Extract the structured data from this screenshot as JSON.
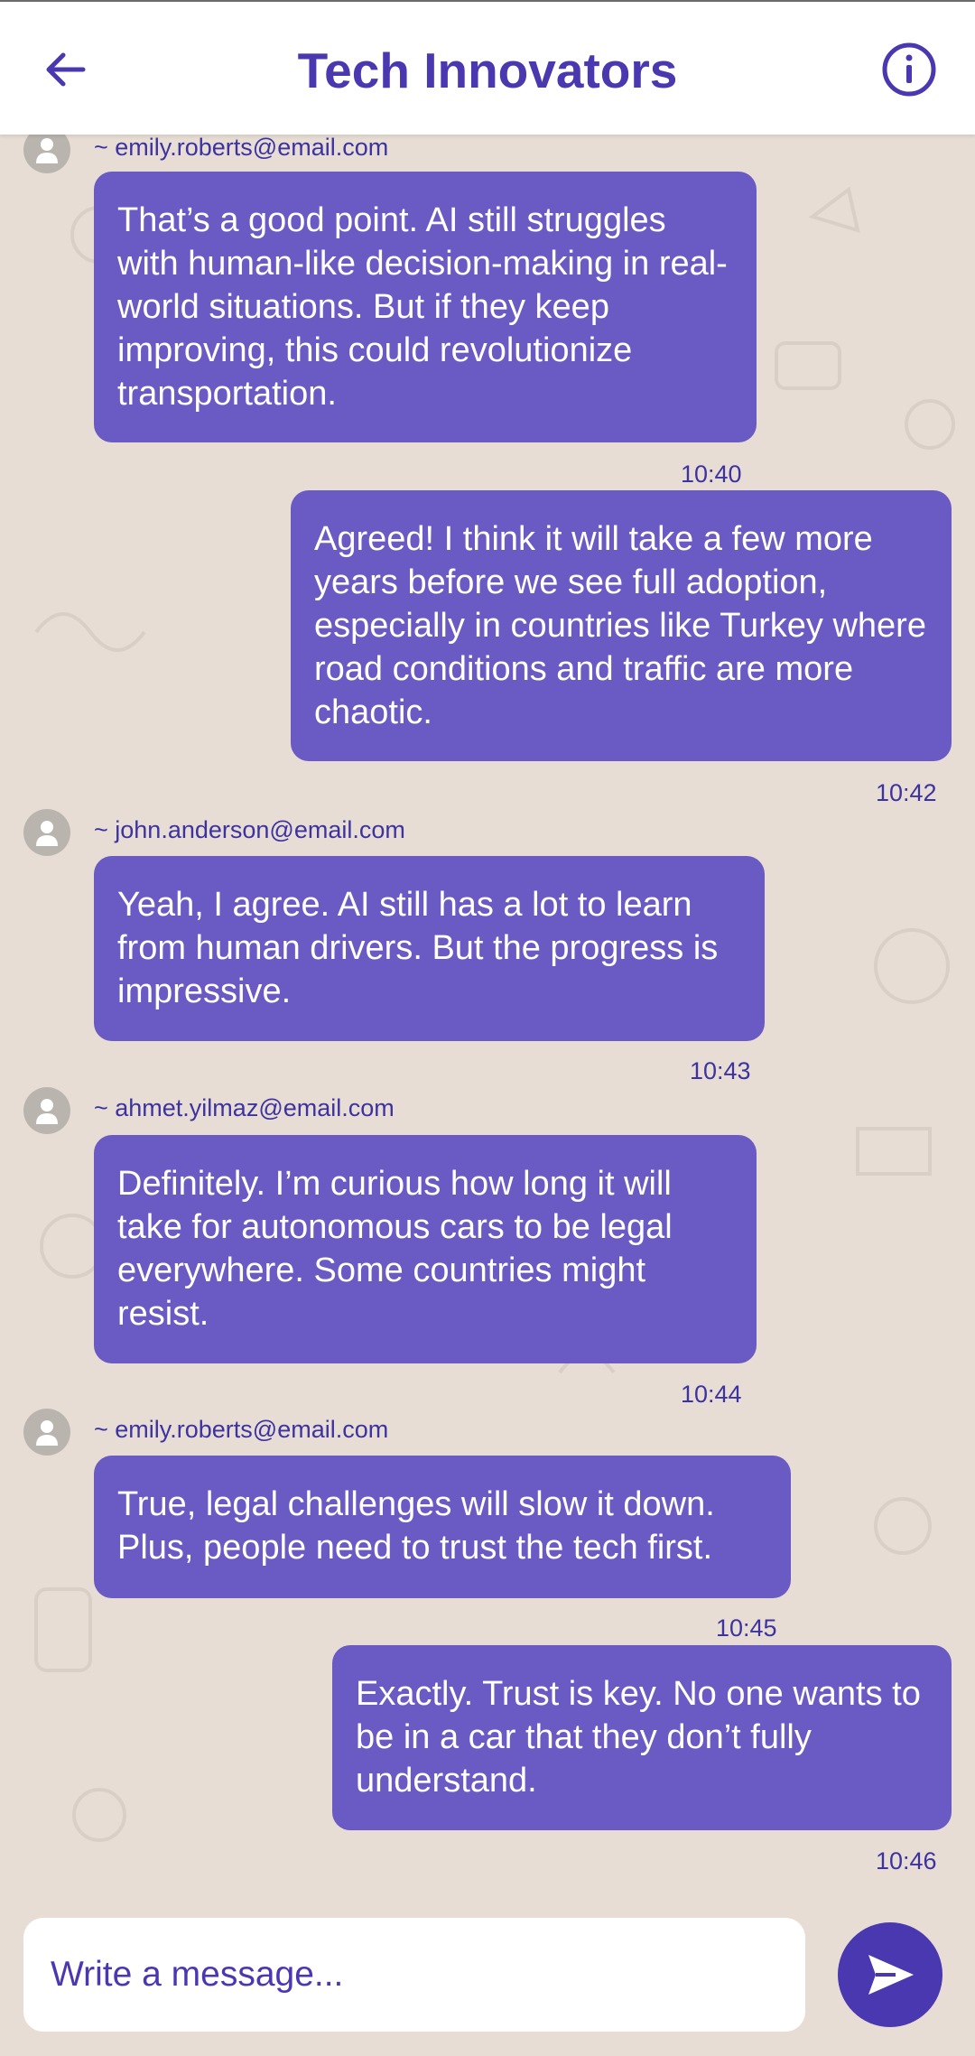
{
  "header": {
    "title": "Tech Innovators",
    "back_icon": "arrow-left-icon",
    "info_icon": "info-icon"
  },
  "messages": [
    {
      "sender": "~ emily.roberts@email.com",
      "text": "That’s a good point. AI still struggles with human-like decision-making in real-world situations. But if they keep improving, this could revolutionize transportation.",
      "time": "10:40",
      "outgoing": false
    },
    {
      "sender": "",
      "text": "Agreed! I think it will take a few more years before we see full adoption, especially in countries like Turkey where road conditions and traffic are more chaotic.",
      "time": "10:42",
      "outgoing": true
    },
    {
      "sender": "~ john.anderson@email.com",
      "text": "Yeah, I agree. AI still has a lot to learn from human drivers. But the progress is impressive.",
      "time": "10:43",
      "outgoing": false
    },
    {
      "sender": "~ ahmet.yilmaz@email.com",
      "text": "Definitely. I’m curious how long it will take for autonomous cars to be legal everywhere. Some countries might resist.",
      "time": "10:44",
      "outgoing": false
    },
    {
      "sender": "~ emily.roberts@email.com",
      "text": "True, legal challenges will slow it down. Plus, people need to trust the tech first.",
      "time": "10:45",
      "outgoing": false
    },
    {
      "sender": "",
      "text": "Exactly. Trust is key. No one wants to be in a car that they don’t fully understand.",
      "time": "10:46",
      "outgoing": true
    }
  ],
  "composer": {
    "placeholder": "Write a message...",
    "send_icon": "send-icon"
  },
  "colors": {
    "accent": "#4a38b0",
    "bubble": "#6a5ac4",
    "background": "#e7ddd4"
  }
}
